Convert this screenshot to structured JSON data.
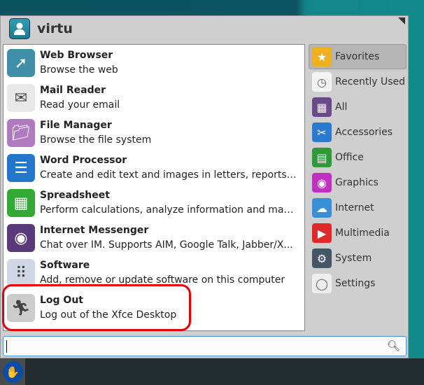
{
  "user": {
    "name": "virtu"
  },
  "apps": [
    {
      "title": "Web Browser",
      "desc": "Browse the web",
      "icon": "compass-icon",
      "color": "#3f8fa8"
    },
    {
      "title": "Mail Reader",
      "desc": "Read your email",
      "icon": "envelope-icon",
      "color": "#e8e8e8"
    },
    {
      "title": "File Manager",
      "desc": "Browse the file system",
      "icon": "folder-icon",
      "color": "#b07ac0"
    },
    {
      "title": "Word Processor",
      "desc": "Create and edit text and images in letters, reports, d...",
      "icon": "document-icon",
      "color": "#2277cc"
    },
    {
      "title": "Spreadsheet",
      "desc": "Perform calculations, analyze information and mana...",
      "icon": "spreadsheet-icon",
      "color": "#33aa33"
    },
    {
      "title": "Internet Messenger",
      "desc": "Chat over IM.  Supports AIM, Google Talk, Jabber/X...",
      "icon": "pidgin-icon",
      "color": "#5a3a7a"
    },
    {
      "title": "Software",
      "desc": "Add, remove or update software on this computer",
      "icon": "software-icon",
      "color": "#d0d8e8"
    },
    {
      "title": "Log Out",
      "desc": "Log out of the Xfce Desktop",
      "icon": "running-man-icon",
      "color": "#cccccc"
    }
  ],
  "categories": [
    {
      "label": "Favorites",
      "icon": "star-icon",
      "color": "#f0b020"
    },
    {
      "label": "Recently Used",
      "icon": "clock-icon",
      "color": "#f4f4f4"
    },
    {
      "label": "All",
      "icon": "grid-icon",
      "color": "#6a4a8a"
    },
    {
      "label": "Accessories",
      "icon": "scissors-icon",
      "color": "#2a7ad0"
    },
    {
      "label": "Office",
      "icon": "office-icon",
      "color": "#2f9a3a"
    },
    {
      "label": "Graphics",
      "icon": "palette-icon",
      "color": "#c030c0"
    },
    {
      "label": "Internet",
      "icon": "cloud-icon",
      "color": "#3a90d8"
    },
    {
      "label": "Multimedia",
      "icon": "play-icon",
      "color": "#e02a2a"
    },
    {
      "label": "System",
      "icon": "gear-icon",
      "color": "#445566"
    },
    {
      "label": "Settings",
      "icon": "toggle-icon",
      "color": "#eeeeee"
    }
  ],
  "search": {
    "value": ""
  }
}
